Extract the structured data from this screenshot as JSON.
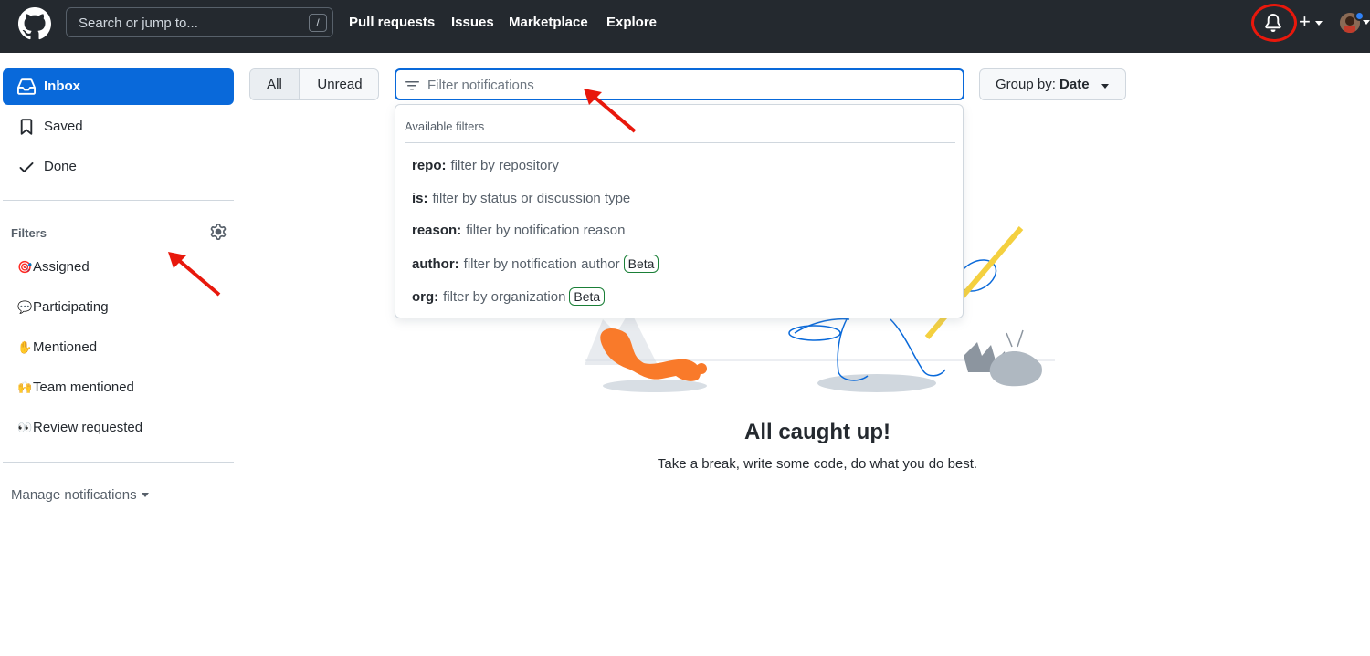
{
  "header": {
    "search_placeholder": "Search or jump to...",
    "search_shortcut": "/",
    "nav": [
      "Pull requests",
      "Issues",
      "Marketplace",
      "Explore"
    ],
    "plus_symbol": "+"
  },
  "sidebar": {
    "items": [
      {
        "label": "Inbox",
        "icon": "inbox-icon"
      },
      {
        "label": "Saved",
        "icon": "bookmark-icon"
      },
      {
        "label": "Done",
        "icon": "check-icon"
      }
    ],
    "filters_title": "Filters",
    "filters": [
      {
        "emoji": "🎯",
        "label": "Assigned"
      },
      {
        "emoji": "💬",
        "label": "Participating"
      },
      {
        "emoji": "✋",
        "label": "Mentioned"
      },
      {
        "emoji": "🙌",
        "label": "Team mentioned"
      },
      {
        "emoji": "👀",
        "label": "Review requested"
      }
    ],
    "manage_label": "Manage notifications"
  },
  "toolbar": {
    "all_label": "All",
    "unread_label": "Unread",
    "filter_placeholder": "Filter notifications",
    "group_by_prefix": "Group by:",
    "group_by_value": "Date"
  },
  "dropdown": {
    "heading": "Available filters",
    "rows": [
      {
        "key": "repo:",
        "desc": "filter by repository",
        "badge": ""
      },
      {
        "key": "is:",
        "desc": "filter by status or discussion type",
        "badge": ""
      },
      {
        "key": "reason:",
        "desc": "filter by notification reason",
        "badge": ""
      },
      {
        "key": "author:",
        "desc": "filter by notification author",
        "badge": "Beta"
      },
      {
        "key": "org:",
        "desc": "filter by organization",
        "badge": "Beta"
      }
    ]
  },
  "empty_state": {
    "title": "All caught up!",
    "subtitle": "Take a break, write some code, do what you do best."
  },
  "colors": {
    "header_bg": "#24292f",
    "accent": "#0969da",
    "annotation_red": "#e8180c",
    "beta_border": "#1a7f37"
  }
}
